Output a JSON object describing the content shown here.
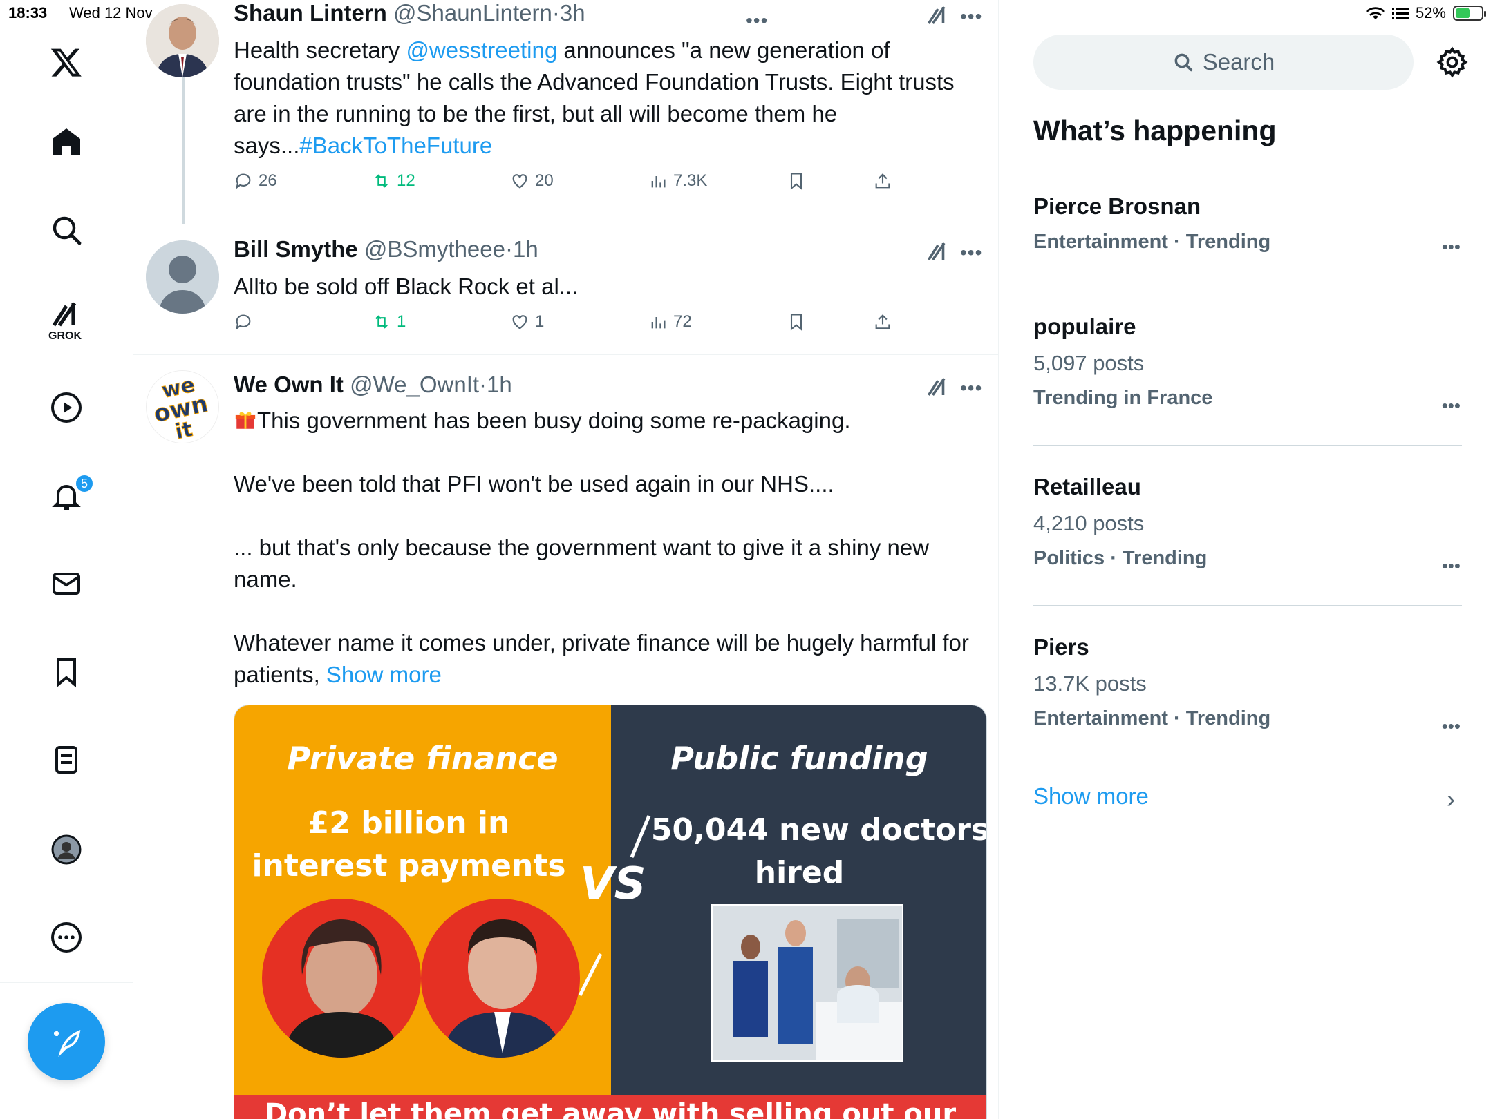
{
  "status_bar": {
    "time": "18:33",
    "date": "Wed 12 Nov",
    "battery": "52%"
  },
  "nav": {
    "grok_label": "GROK",
    "notifications_badge": "5"
  },
  "tweets": [
    {
      "name": "Shaun Lintern",
      "handle": "@ShaunLintern",
      "time": "3h",
      "text_pre": "Health secretary ",
      "mention": "@wesstreeting",
      "text_mid": " announces \"a new generation of foundation trusts\" he calls the Advanced Foundation Trusts. Eight trusts are in the running to be the first, but all will become them he says...",
      "hashtag": "#BackToTheFuture",
      "replies": "26",
      "reposts": "12",
      "likes": "20",
      "views": "7.3K"
    },
    {
      "name": "Bill Smythe",
      "handle": "@BSmytheee",
      "time": "1h",
      "text": "Allto be sold off Black Rock et al...",
      "replies": "",
      "reposts": "1",
      "likes": "1",
      "views": "72"
    },
    {
      "name": "We Own It",
      "handle": "@We_OwnIt",
      "time": "1h",
      "line1": "This government has been busy doing some re-packaging.",
      "line2": "We've been told that PFI won't be used again in our NHS....",
      "line3": "... but that's only because the government want to give it a shiny new name.",
      "line4": "Whatever name it comes under, private finance will be hugely harmful for patients, ",
      "show_more": "Show more",
      "avatar_text": [
        "we",
        "own",
        "it"
      ],
      "media": {
        "left_title": "Private finance",
        "left_sub1": "£2 billion in",
        "left_sub2": "interest payments",
        "vs": "VS",
        "right_title": "Public funding",
        "right_sub1": "50,044 new doctors",
        "right_sub2": "hired",
        "banner": "Don’t let them get away with selling out our NHS"
      }
    }
  ],
  "sidebar": {
    "search_placeholder": "Search",
    "title": "What’s happening",
    "trends": [
      {
        "name": "Pierce Brosnan",
        "count": "",
        "context": "Entertainment · Trending"
      },
      {
        "name": "populaire",
        "count": "5,097 posts",
        "context": "Trending in France"
      },
      {
        "name": "Retailleau",
        "count": "4,210 posts",
        "context": "Politics · Trending"
      },
      {
        "name": "Piers",
        "count": "13.7K posts",
        "context": "Entertainment · Trending"
      }
    ],
    "show_more": "Show more"
  },
  "colors": {
    "accent": "#1d9bf0",
    "repost": "#00ba7c",
    "muted": "#536471"
  }
}
